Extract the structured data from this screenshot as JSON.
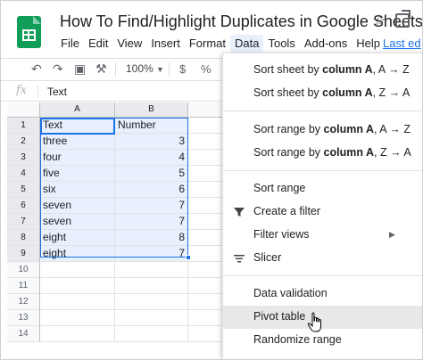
{
  "header": {
    "title": "How To Find/Highlight Duplicates in Google Sheets",
    "menus": [
      "File",
      "Edit",
      "View",
      "Insert",
      "Format",
      "Data",
      "Tools",
      "Add-ons",
      "Help"
    ],
    "active_menu": "Data",
    "last_edit": "Last ed"
  },
  "toolbar": {
    "zoom": "100%",
    "currency": "$",
    "percent": "%"
  },
  "formula_bar": {
    "fx": "fx",
    "value": "Text"
  },
  "grid": {
    "columns": [
      "A",
      "B"
    ],
    "rows": [
      "1",
      "2",
      "3",
      "4",
      "5",
      "6",
      "7",
      "8",
      "9",
      "10",
      "11",
      "12",
      "13",
      "14"
    ],
    "cells": [
      [
        "Text",
        "Number"
      ],
      [
        "three",
        "3"
      ],
      [
        "four",
        "4"
      ],
      [
        "five",
        "5"
      ],
      [
        "six",
        "6"
      ],
      [
        "seven",
        "7"
      ],
      [
        "seven",
        "7"
      ],
      [
        "eight",
        "8"
      ],
      [
        "eight",
        "7"
      ]
    ]
  },
  "data_menu": {
    "sort_sheet_az": {
      "pre": "Sort sheet by ",
      "bold": "column A",
      "post": ", A → Z"
    },
    "sort_sheet_za": {
      "pre": "Sort sheet by ",
      "bold": "column A",
      "post": ", Z → A"
    },
    "sort_range_az": {
      "pre": "Sort range by ",
      "bold": "column A",
      "post": ", A → Z"
    },
    "sort_range_za": {
      "pre": "Sort range by ",
      "bold": "column A",
      "post": ", Z → A"
    },
    "sort_range": "Sort range",
    "create_filter": "Create a filter",
    "filter_views": "Filter views",
    "slicer": "Slicer",
    "data_validation": "Data validation",
    "pivot_table": "Pivot table",
    "randomize_range": "Randomize range"
  },
  "colors": {
    "accent": "#1a73e8",
    "selection": "#e8f0fe",
    "sheets_green": "#0f9d58"
  }
}
